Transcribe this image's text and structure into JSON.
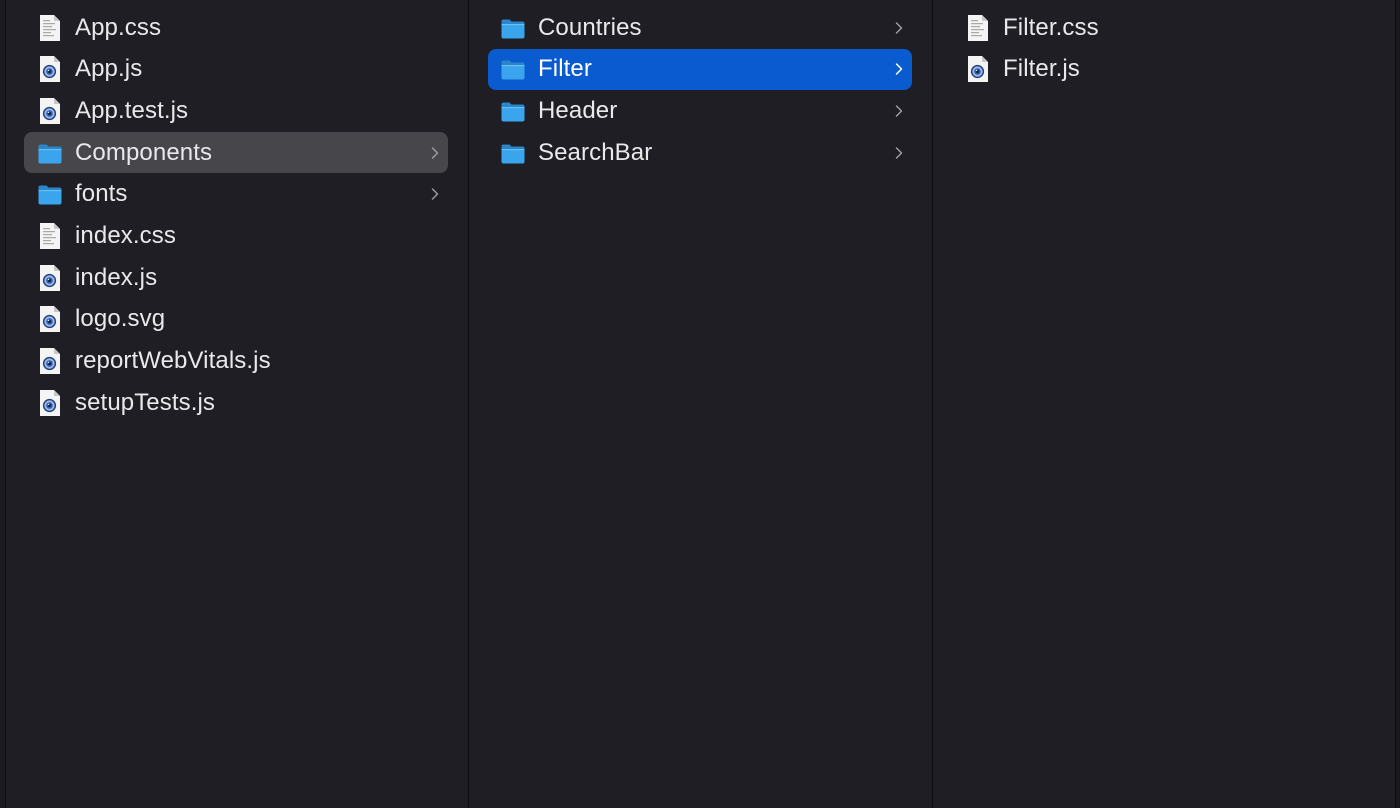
{
  "columns": [
    {
      "id": "project-root",
      "items": [
        {
          "name": "App.css",
          "kind": "text-file",
          "icon": "css-file-icon"
        },
        {
          "name": "App.js",
          "kind": "js-file",
          "icon": "js-file-icon"
        },
        {
          "name": "App.test.js",
          "kind": "js-file",
          "icon": "js-file-icon"
        },
        {
          "name": "Components",
          "kind": "folder",
          "icon": "folder-icon",
          "state": "selected-inactive"
        },
        {
          "name": "fonts",
          "kind": "folder",
          "icon": "folder-icon"
        },
        {
          "name": "index.css",
          "kind": "text-file",
          "icon": "css-file-icon"
        },
        {
          "name": "index.js",
          "kind": "js-file",
          "icon": "js-file-icon"
        },
        {
          "name": "logo.svg",
          "kind": "svg-file",
          "icon": "svg-file-icon"
        },
        {
          "name": "reportWebVitals.js",
          "kind": "js-file",
          "icon": "js-file-icon"
        },
        {
          "name": "setupTests.js",
          "kind": "js-file",
          "icon": "js-file-icon"
        }
      ]
    },
    {
      "id": "Components",
      "items": [
        {
          "name": "Countries",
          "kind": "folder",
          "icon": "folder-icon"
        },
        {
          "name": "Filter",
          "kind": "folder",
          "icon": "folder-icon",
          "state": "selected-active"
        },
        {
          "name": "Header",
          "kind": "folder",
          "icon": "folder-icon"
        },
        {
          "name": "SearchBar",
          "kind": "folder",
          "icon": "folder-icon"
        }
      ]
    },
    {
      "id": "Filter",
      "items": [
        {
          "name": "Filter.css",
          "kind": "text-file",
          "icon": "css-file-icon"
        },
        {
          "name": "Filter.js",
          "kind": "js-file",
          "icon": "js-file-icon"
        }
      ]
    }
  ],
  "colors": {
    "background": "#1f1e24",
    "selection_active": "#0a5bd0",
    "selection_inactive": "#46464b",
    "text": "#e9e9eb",
    "folder": "#3aa4ec"
  }
}
